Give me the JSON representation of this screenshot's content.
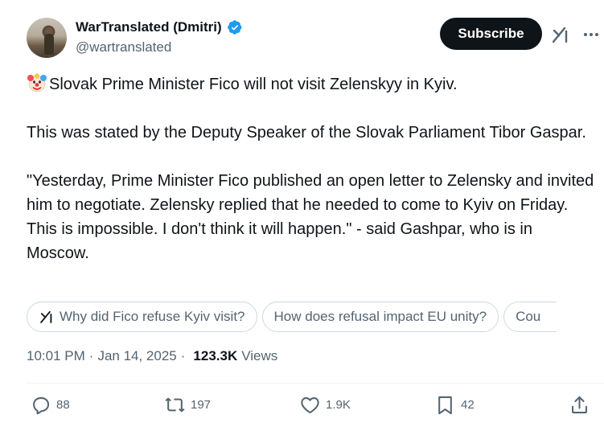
{
  "author": {
    "display_name": "WarTranslated (Dmitri)",
    "handle": "@wartranslated",
    "verified": true
  },
  "header": {
    "subscribe_label": "Subscribe"
  },
  "tweet": {
    "lead_emoji": "clown-face",
    "paragraphs": [
      "Slovak Prime Minister Fico will not visit Zelenskyy in Kyiv.",
      "This was stated by the Deputy Speaker of the Slovak Parliament Tibor Gaspar.",
      "\"Yesterday, Prime Minister Fico published an open letter to Zelensky and invited him to negotiate. Zelensky replied that he needed to come to Kyiv on Friday. This is impossible. I don't think it will happen.\" - said Gashpar, who is in Moscow."
    ]
  },
  "grok_suggestions": [
    "Why did Fico refuse Kyiv visit?",
    "How does refusal impact EU unity?",
    "Cou"
  ],
  "meta": {
    "time": "10:01 PM",
    "date": "Jan 14, 2025",
    "views_count": "123.3K",
    "views_label": "Views"
  },
  "actions": {
    "replies": "88",
    "reposts": "197",
    "likes": "1.9K",
    "bookmarks": "42"
  },
  "colors": {
    "text": "#0f1419",
    "secondary": "#536471",
    "verified_blue": "#1d9bf0",
    "button_dark": "#0f1419",
    "border": "#cfd9de"
  }
}
